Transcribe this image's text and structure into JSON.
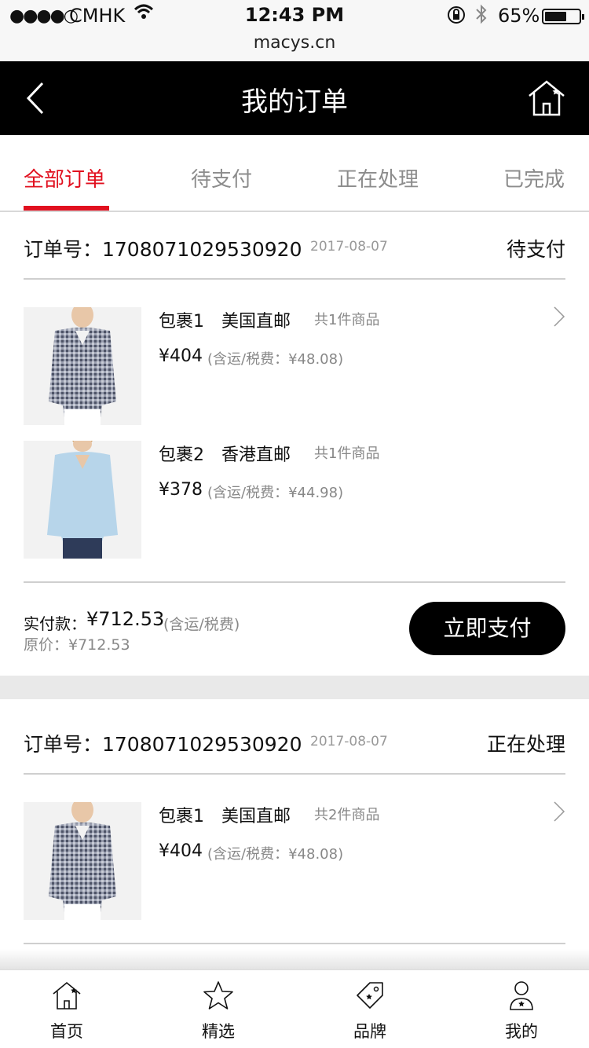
{
  "status_bar": {
    "signal": "●●●●○",
    "carrier": "CMHK",
    "time": "12:43 PM",
    "url": "macys.cn",
    "battery": "65%",
    "battery_level": 0.65
  },
  "header": {
    "title": "我的订单"
  },
  "tabs": [
    {
      "label": "全部订单",
      "active": true
    },
    {
      "label": "待支付",
      "active": false
    },
    {
      "label": "正在处理",
      "active": false
    },
    {
      "label": "已完成",
      "active": false
    }
  ],
  "orders": [
    {
      "number": "订单号：1708071029530920",
      "date": "2017-08-07",
      "status": "待支付",
      "packages": [
        {
          "name": "包裹1　美国直邮",
          "count": "共1件商品",
          "price": "¥404",
          "tax": "(含运/税费：¥48.08)",
          "image": "gingham-shirt"
        },
        {
          "name": "包裹2　香港直邮",
          "count": "共1件商品",
          "price": "¥378",
          "tax": "(含运/税费：¥44.98)",
          "image": "blue-shirt"
        }
      ],
      "paid_label": "实付款：",
      "paid_amount": "¥712.53",
      "paid_note": "(含运/税费)",
      "original_price": "原价：¥712.53",
      "pay_button": "立即支付"
    },
    {
      "number": "订单号：1708071029530920",
      "date": "2017-08-07",
      "status": "正在处理",
      "packages": [
        {
          "name": "包裹1　美国直邮",
          "count": "共2件商品",
          "price": "¥404",
          "tax": "(含运/税费：¥48.08)",
          "image": "gingham-shirt"
        }
      ]
    }
  ],
  "bottom_nav": [
    {
      "label": "首页",
      "icon": "home-icon"
    },
    {
      "label": "精选",
      "icon": "star-icon"
    },
    {
      "label": "品牌",
      "icon": "tag-icon"
    },
    {
      "label": "我的",
      "icon": "user-icon"
    }
  ]
}
